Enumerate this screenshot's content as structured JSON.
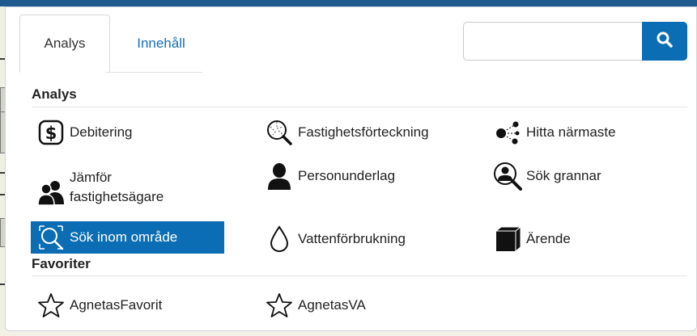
{
  "tabs": {
    "analysis": "Analys",
    "content": "Innehåll"
  },
  "search": {
    "placeholder": "",
    "value": ""
  },
  "sections": {
    "analysis_title": "Analys",
    "favorites_title": "Favoriter"
  },
  "analysis_items": {
    "debitering": "Debitering",
    "fastighetsforteckning": "Fastighetsförteckning",
    "hitta_narmaste": "Hitta närmaste",
    "jamfor_line1": "Jämför",
    "jamfor_line2": "fastighetsägare",
    "personunderlag": "Personunderlag",
    "sok_grannar": "Sök grannar",
    "sok_inom_omrade": "Sök inom område",
    "vattenforbrukning": "Vattenförbrukning",
    "arende": "Ärende"
  },
  "favorite_items": {
    "agnetas_favorit": "AgnetasFavorit",
    "agnetas_va": "AgnetasVA"
  },
  "colors": {
    "accent": "#0b6db3",
    "link": "#1a6fb3",
    "top_bar": "#1d5a8e"
  },
  "icons": {
    "search": "search-icon",
    "debitering": "dollar-icon",
    "fastighetsforteckning": "map-search-icon",
    "hitta_narmaste": "nearest-network-icon",
    "jamfor": "people-icon",
    "personunderlag": "person-icon",
    "sok_grannar": "person-search-icon",
    "sok_inom_omrade": "area-search-icon",
    "vattenforbrukning": "water-drop-icon",
    "arende": "cube-icon",
    "favorit": "star-icon"
  }
}
